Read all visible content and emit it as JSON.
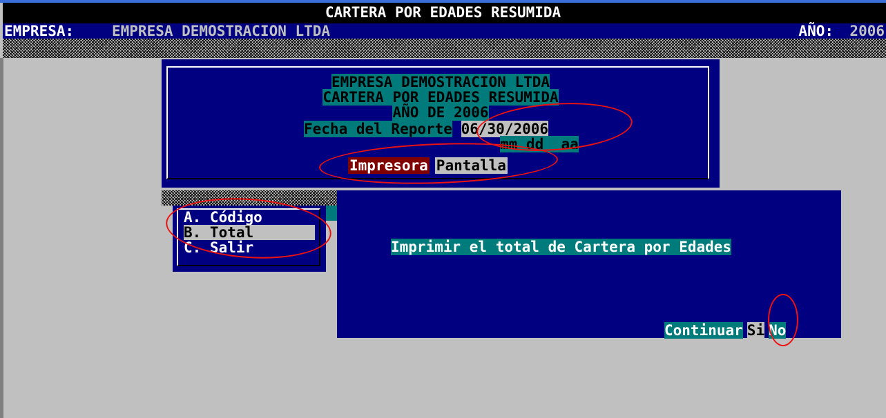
{
  "window": {
    "title": "CARTERA POR EDADES RESUMIDA",
    "company_label": "EMPRESA:",
    "company_name": "EMPRESA DEMOSTRACION LTDA",
    "year_label": "AÑO:",
    "year_value": "2006"
  },
  "report_header": {
    "company": "EMPRESA DEMOSTRACION LTDA",
    "report_name": "CARTERA POR EDADES RESUMIDA",
    "year_line": "AÑO DE 2006",
    "date_label": "Fecha del Reporte",
    "date_value": "06/30/2006",
    "date_mask": "mm dd  aa",
    "output_options": [
      "Impresora",
      "Pantalla"
    ],
    "selected_output": "Impresora"
  },
  "menu": {
    "items": [
      {
        "label": "A. Código"
      },
      {
        "label": "B. Total"
      },
      {
        "label": "C. Salir"
      }
    ],
    "selected": "B. Total"
  },
  "prompt": {
    "message": "Imprimir el total de Cartera por Edades",
    "continue_label": "Continuar",
    "yes_label": "Si",
    "no_label": "No"
  },
  "colors": {
    "background": "#c0c0c0",
    "panel": "#000080",
    "highlight": "#007b7b",
    "selected_output": "#800000",
    "annotation": "#ee1111"
  }
}
